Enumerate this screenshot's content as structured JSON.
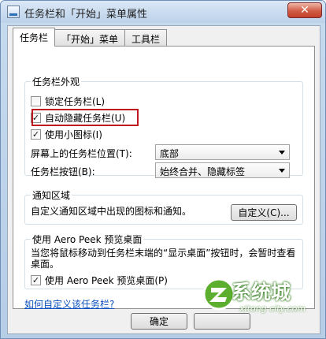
{
  "window": {
    "title": "任务栏和「开始」菜单属性",
    "close_label": "✕"
  },
  "tabs": [
    {
      "label": "任务栏"
    },
    {
      "label": "「开始」菜单"
    },
    {
      "label": "工具栏"
    }
  ],
  "appearance": {
    "group_label": "任务栏外观",
    "lock_taskbar": {
      "label": "锁定任务栏(L)",
      "checked": false
    },
    "auto_hide": {
      "label": "自动隐藏任务栏(U)",
      "checked": true
    },
    "small_icons": {
      "label": "使用小图标(I)",
      "checked": true
    },
    "location_label": "屏幕上的任务栏位置(T):",
    "location_value": "底部",
    "buttons_label": "任务栏按钮(B):",
    "buttons_value": "始终合并、隐藏标签"
  },
  "notification": {
    "group_label": "通知区域",
    "description": "自定义通知区域中出现的图标和通知。",
    "customize_button": "自定义(C)..."
  },
  "aero_peek": {
    "group_label": "使用 Aero Peek 预览桌面",
    "description": "当您将鼠标移动到任务栏末端的“显示桌面”按钮时，会暂时查看桌面。",
    "checkbox_label": "使用 Aero Peek 预览桌面(P)",
    "checked": true
  },
  "help_link": "如何自定义该任务栏?",
  "footer": {
    "ok_button": "确定"
  },
  "watermark": {
    "text": "系统城",
    "url": "xitong city.com"
  },
  "colors": {
    "highlight": "#c0171c",
    "link": "#0a4fbd",
    "watermark_green": "#2d7a17"
  }
}
